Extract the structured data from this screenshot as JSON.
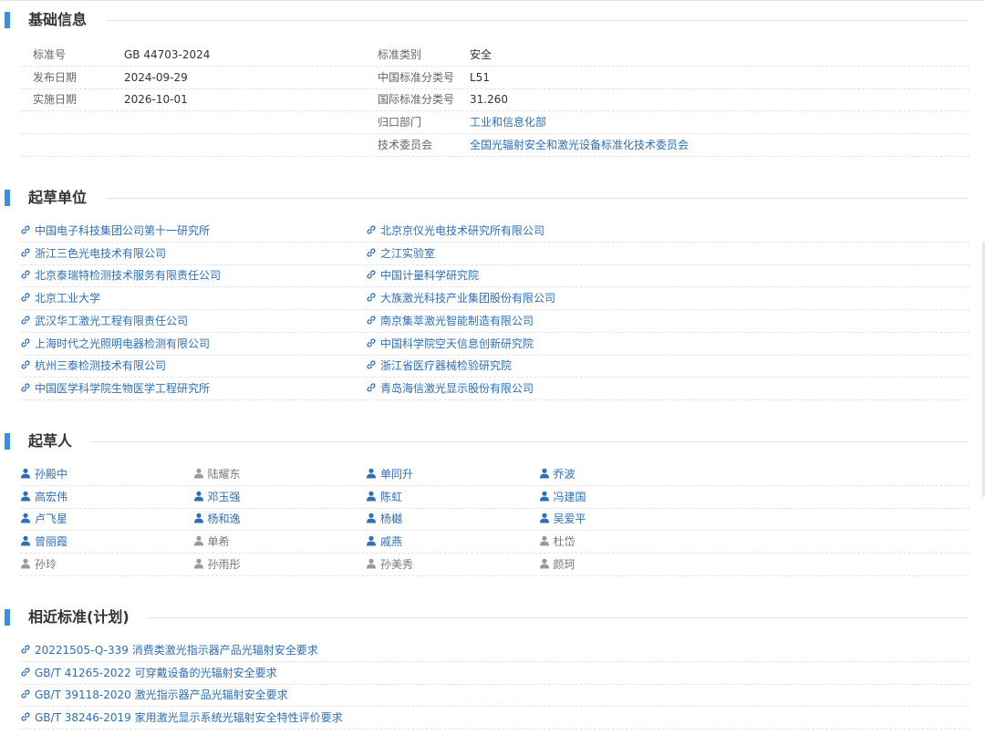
{
  "basic": {
    "title": "基础信息",
    "left": [
      {
        "label": "标准号",
        "value": "GB 44703-2024"
      },
      {
        "label": "发布日期",
        "value": "2024-09-29"
      },
      {
        "label": "实施日期",
        "value": "2026-10-01"
      }
    ],
    "right": [
      {
        "label": "标准类别",
        "value": "安全"
      },
      {
        "label": "中国标准分类号",
        "value": "L51"
      },
      {
        "label": "国际标准分类号",
        "value": "31.260"
      },
      {
        "label": "归口部门",
        "value": "工业和信息化部"
      },
      {
        "label": "技术委员会",
        "value": "全国光辐射安全和激光设备标准化技术委员会"
      }
    ]
  },
  "drafting_units": {
    "title": "起草单位",
    "rows": [
      [
        "中国电子科技集团公司第十一研究所",
        "北京京仪光电技术研究所有限公司"
      ],
      [
        "浙江三色光电技术有限公司",
        "之江实验室"
      ],
      [
        "北京泰瑞特检测技术服务有限责任公司",
        "中国计量科学研究院"
      ],
      [
        "北京工业大学",
        "大族激光科技产业集团股份有限公司"
      ],
      [
        "武汉华工激光工程有限责任公司",
        "南京集萃激光智能制造有限公司"
      ],
      [
        "上海时代之光照明电器检测有限公司",
        "中国科学院空天信息创新研究院"
      ],
      [
        "杭州三泰检测技术有限公司",
        "浙江省医疗器械检验研究院"
      ],
      [
        "中国医学科学院生物医学工程研究所",
        "青岛海信激光显示股份有限公司"
      ]
    ]
  },
  "drafters": {
    "title": "起草人",
    "rows": [
      [
        {
          "name": "孙殿中",
          "active": true
        },
        {
          "name": "陆耀东",
          "active": false
        },
        {
          "name": "单同升",
          "active": true
        },
        {
          "name": "乔波",
          "active": true
        }
      ],
      [
        {
          "name": "高宏伟",
          "active": true
        },
        {
          "name": "邓玉强",
          "active": true
        },
        {
          "name": "陈虹",
          "active": true
        },
        {
          "name": "冯建国",
          "active": true
        }
      ],
      [
        {
          "name": "卢飞星",
          "active": true
        },
        {
          "name": "杨和逸",
          "active": true
        },
        {
          "name": "杨樾",
          "active": true
        },
        {
          "name": "吴爱平",
          "active": true
        }
      ],
      [
        {
          "name": "曾丽霞",
          "active": true
        },
        {
          "name": "单希",
          "active": false
        },
        {
          "name": "戚燕",
          "active": true
        },
        {
          "name": "杜岱",
          "active": false
        }
      ],
      [
        {
          "name": "孙玲",
          "active": false
        },
        {
          "name": "孙雨彤",
          "active": false
        },
        {
          "name": "孙美秀",
          "active": false
        },
        {
          "name": "颜珂",
          "active": false
        }
      ]
    ]
  },
  "similar": {
    "title": "相近标准(计划)",
    "items": [
      {
        "code": "20221505-Q-339",
        "name": "消费类激光指示器产品光辐射安全要求"
      },
      {
        "code": "GB/T 41265-2022",
        "name": "可穿戴设备的光辐射安全要求"
      },
      {
        "code": "GB/T 39118-2020",
        "name": "激光指示器产品光辐射安全要求"
      },
      {
        "code": "GB/T 38246-2019",
        "name": "家用激光显示系统光辐射安全特性评价要求"
      }
    ]
  },
  "colors": {
    "accent": "#3b8fe0",
    "link": "#2d6fb7",
    "person_active": "#2d6fb7",
    "person_inactive": "#999999"
  },
  "icons": {
    "link": "link-icon",
    "person": "person-icon"
  }
}
